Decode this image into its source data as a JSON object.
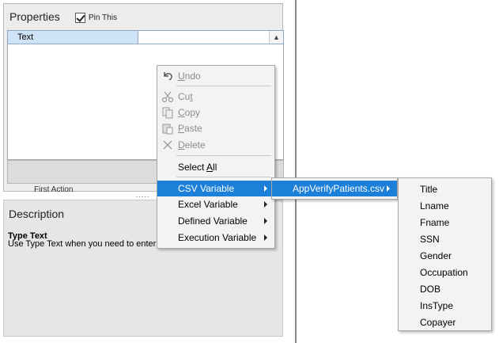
{
  "properties": {
    "title": "Properties",
    "pin_label": "Pin This",
    "grid_row_label": "Text",
    "first_action_label": "First Action"
  },
  "description": {
    "title": "Description",
    "heading": "Type Text",
    "text": "Use Type Text when you need to enter a"
  },
  "context_menu": {
    "undo": {
      "pre": "",
      "key": "U",
      "post": "ndo"
    },
    "cut": {
      "pre": "Cu",
      "key": "t",
      "post": ""
    },
    "copy": {
      "pre": "",
      "key": "C",
      "post": "opy"
    },
    "paste": {
      "pre": "",
      "key": "P",
      "post": "aste"
    },
    "delete": {
      "pre": "",
      "key": "D",
      "post": "elete"
    },
    "select_all": {
      "pre": "Select ",
      "key": "A",
      "post": "ll"
    },
    "submenus": [
      "CSV Variable",
      "Excel Variable",
      "Defined Variable",
      "Execution Variable"
    ]
  },
  "csv_menu": {
    "file": "AppVerifyPatients.csv"
  },
  "fields_menu": {
    "items": [
      "Title",
      "Lname",
      "Fname",
      "SSN",
      "Gender",
      "Occupation",
      "DOB",
      "InsType",
      "Copayer"
    ]
  },
  "colors": {
    "highlight": "#1c7fd8",
    "selected_row": "#cfe3f7"
  }
}
